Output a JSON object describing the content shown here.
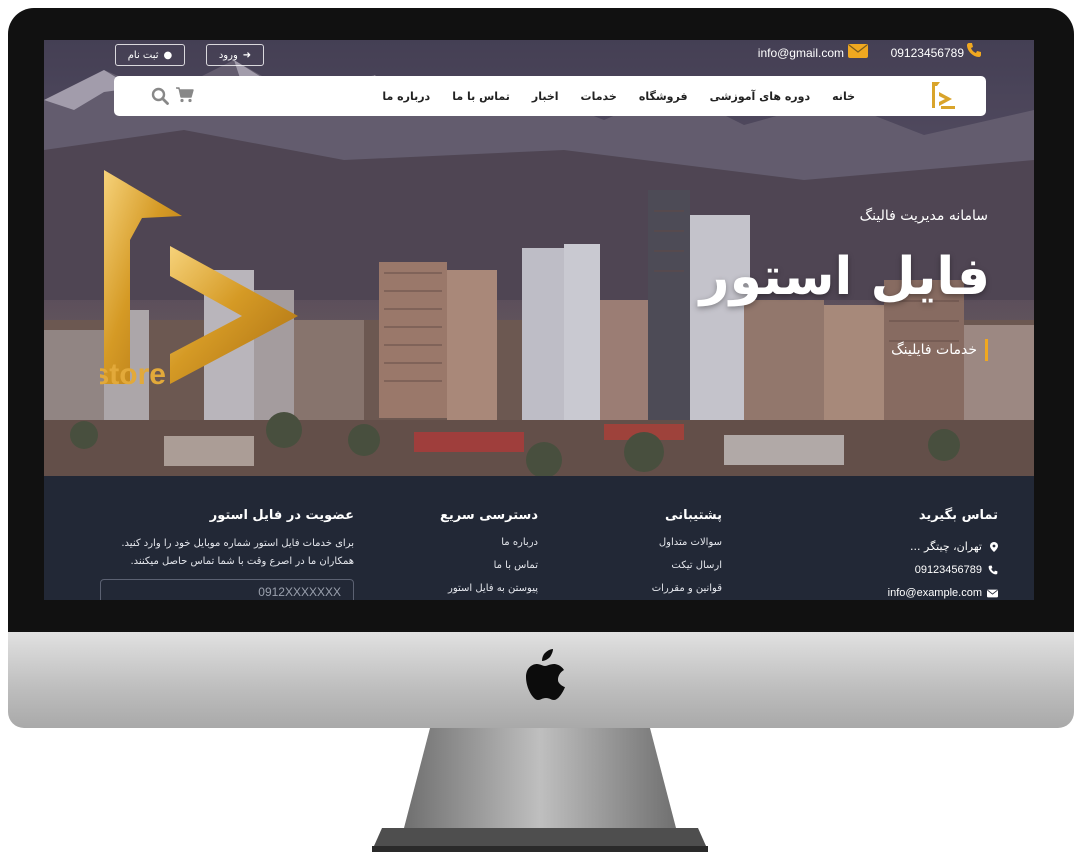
{
  "topbar": {
    "phone": "09123456789",
    "email": "info@gmail.com",
    "login_label": "ورود",
    "register_label": "ثبت نام"
  },
  "nav": {
    "items": [
      "خانه",
      "دوره های آموزشی",
      "فروشگاه",
      "خدمات",
      "اخبار",
      "تماس با ما",
      "درباره ما"
    ]
  },
  "hero": {
    "subtitle": "سامانه مدیریت فالینگ",
    "title": "فایل استور",
    "tagline": "خدمات فایلینگ",
    "logo_text": "ile store"
  },
  "footer": {
    "contact": {
      "title": "تماس بگیرید",
      "address": "تهران، چیتگر ...",
      "phone": "09123456789",
      "email": "info@example.com"
    },
    "support": {
      "title": "پشتیبانی",
      "links": [
        "سوالات متداول",
        "ارسال تیکت",
        "قوانین و مقررات"
      ]
    },
    "quick": {
      "title": "دسترسی سریع",
      "links": [
        "درباره ما",
        "تماس با ما",
        "پیوستن به فایل استور"
      ]
    },
    "member": {
      "title": "عضویت در فایل استور",
      "text": "برای خدمات فایل استور شماره موبایل خود را وارد کنید. همکاران ما در اصرع وقت با شما تماس حاصل میکنند.",
      "placeholder": "0912XXXXXXX"
    }
  },
  "colors": {
    "accent": "#f0a820",
    "footer_bg": "#222836",
    "navbar_bg": "#ffffff"
  }
}
